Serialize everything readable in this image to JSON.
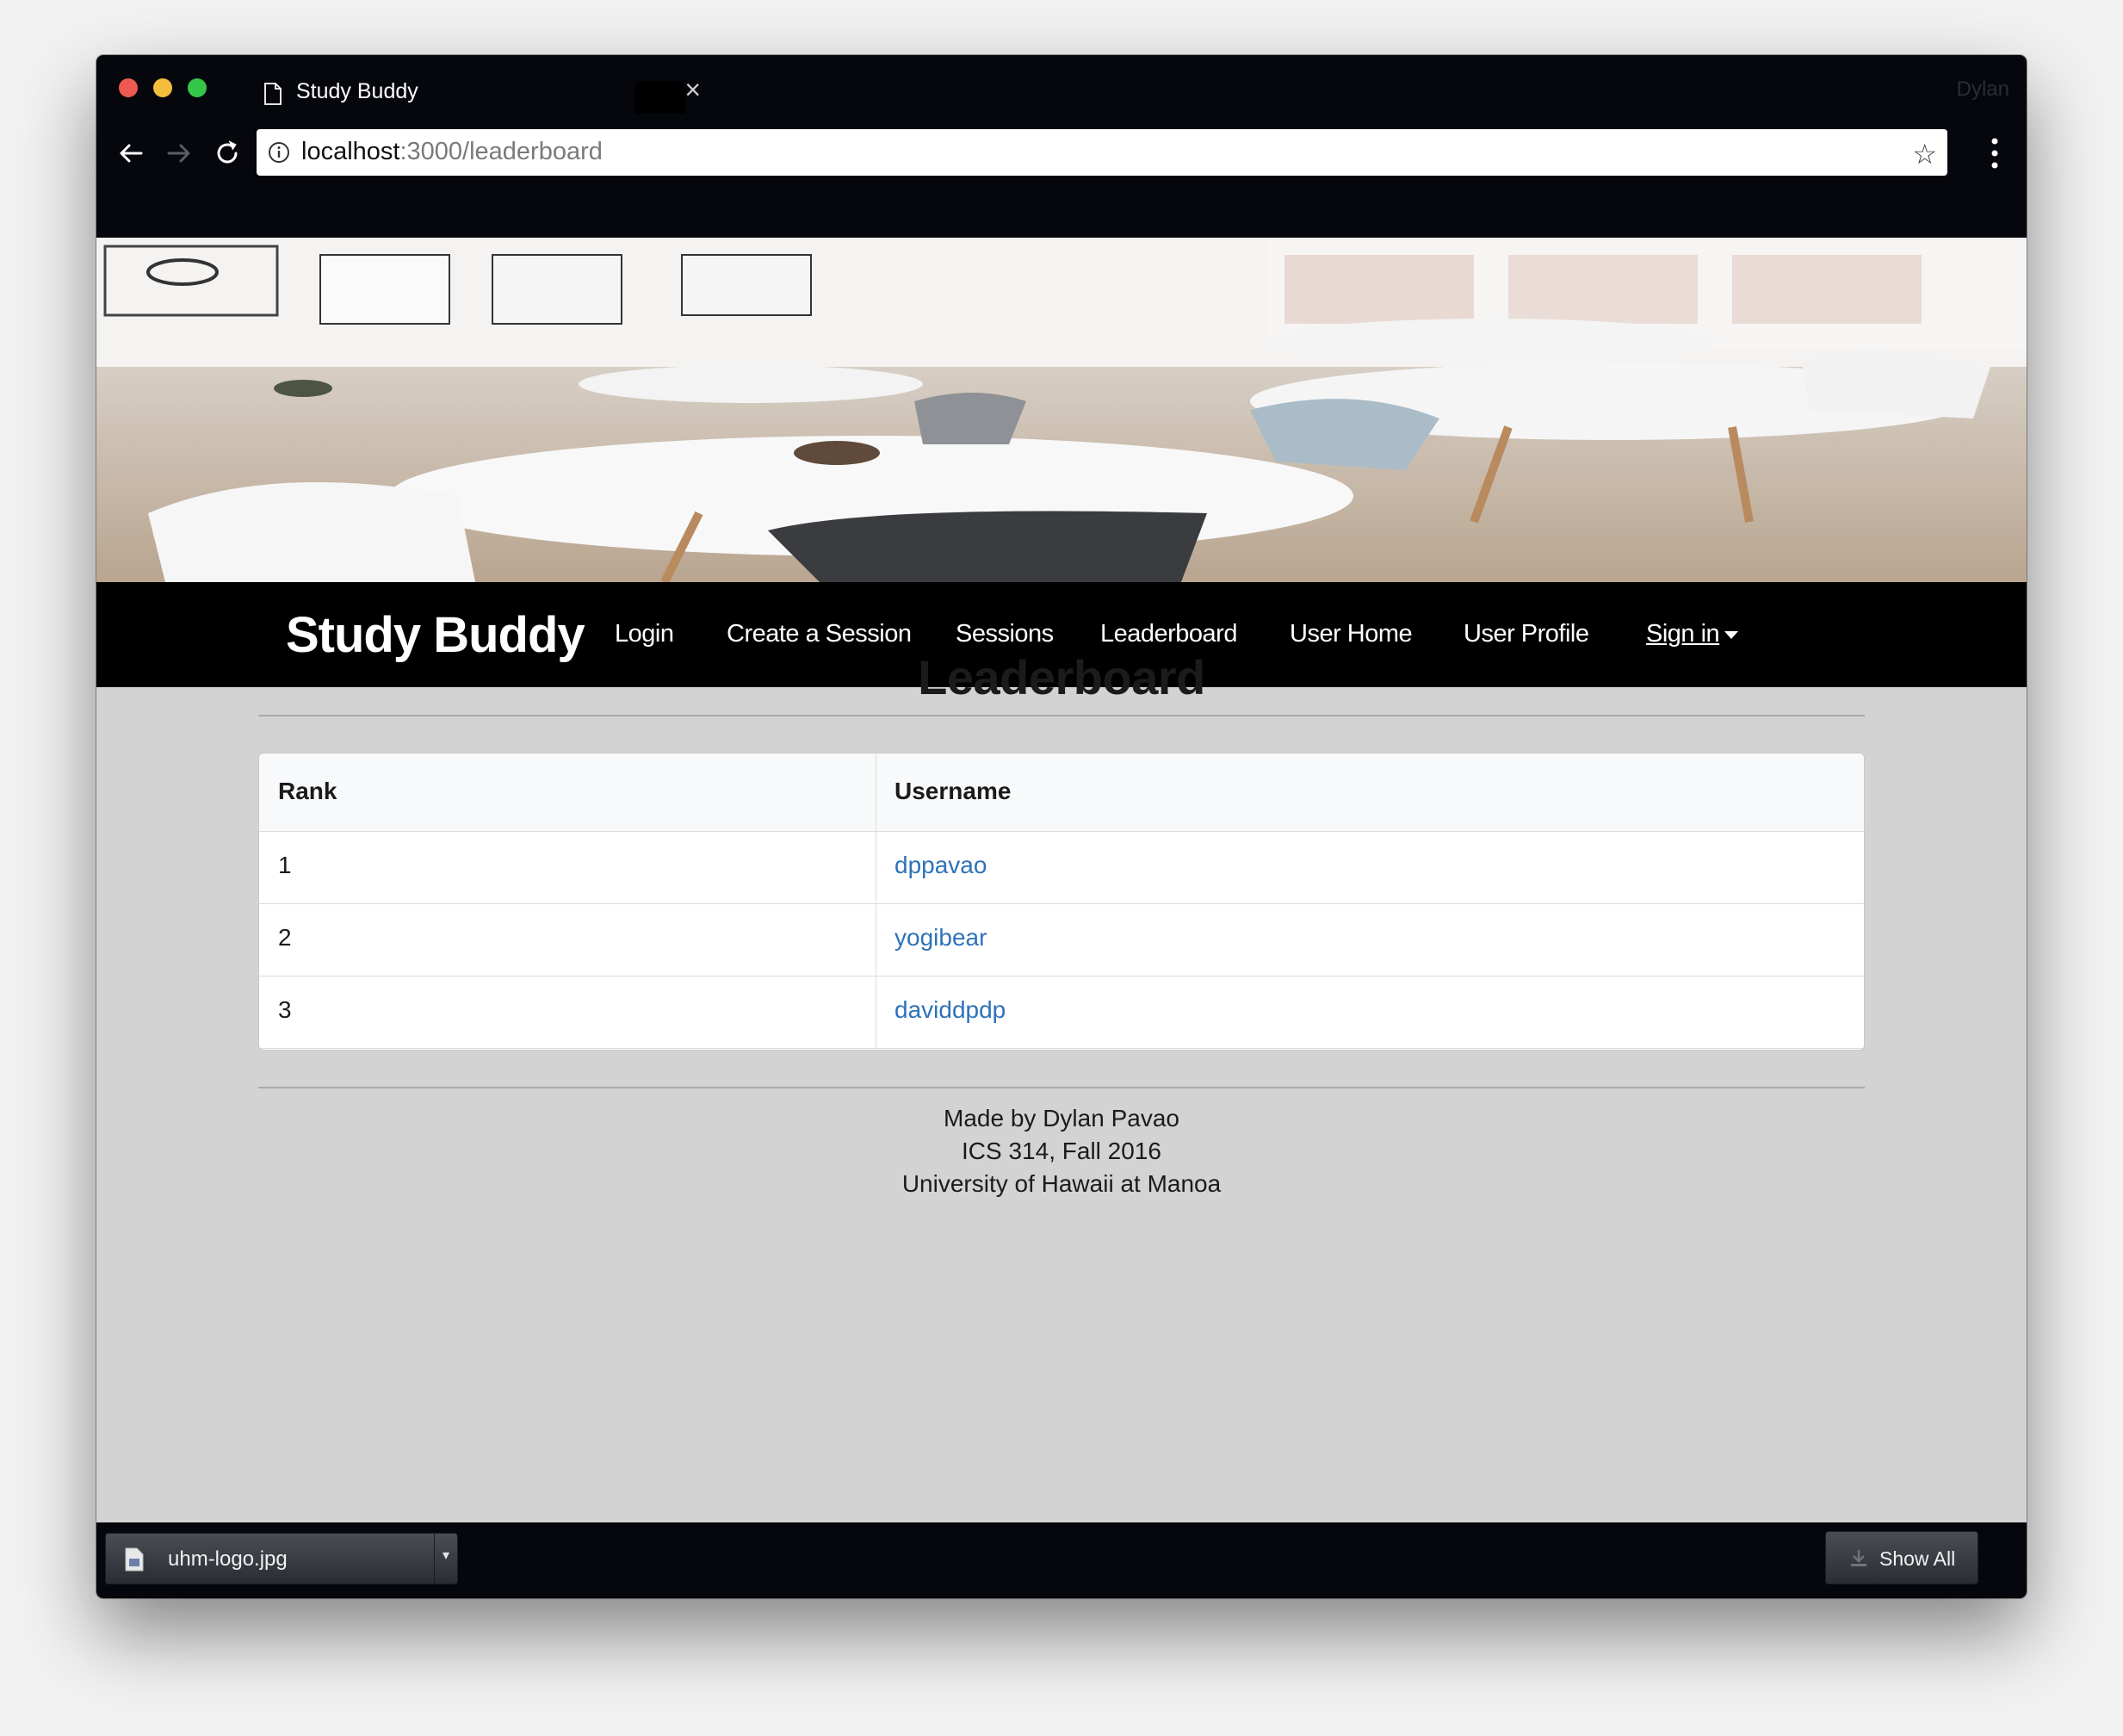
{
  "browser": {
    "tab_title": "Study Buddy",
    "profile_name": "Dylan",
    "url_host": "localhost",
    "url_path": ":3000/leaderboard"
  },
  "navbar": {
    "brand": "Study Buddy",
    "links": [
      "Login",
      "Create a Session",
      "Sessions",
      "Leaderboard",
      "User Home",
      "User Profile"
    ],
    "signin": "Sign in"
  },
  "page": {
    "title": "Leaderboard"
  },
  "table": {
    "headers": [
      "Rank",
      "Username"
    ],
    "rows": [
      {
        "rank": "1",
        "username": "dppavao"
      },
      {
        "rank": "2",
        "username": "yogibear"
      },
      {
        "rank": "3",
        "username": "daviddpdp"
      }
    ]
  },
  "footer": {
    "lines": [
      "Made by Dylan Pavao",
      "ICS 314, Fall 2016",
      "University of Hawaii at Manoa"
    ]
  },
  "downloads": {
    "file_name": "uhm-logo.jpg",
    "show_all": "Show All"
  },
  "colors": {
    "link": "#2e72b8",
    "navbar_bg": "#000000",
    "page_bg": "#d3d3d3"
  }
}
